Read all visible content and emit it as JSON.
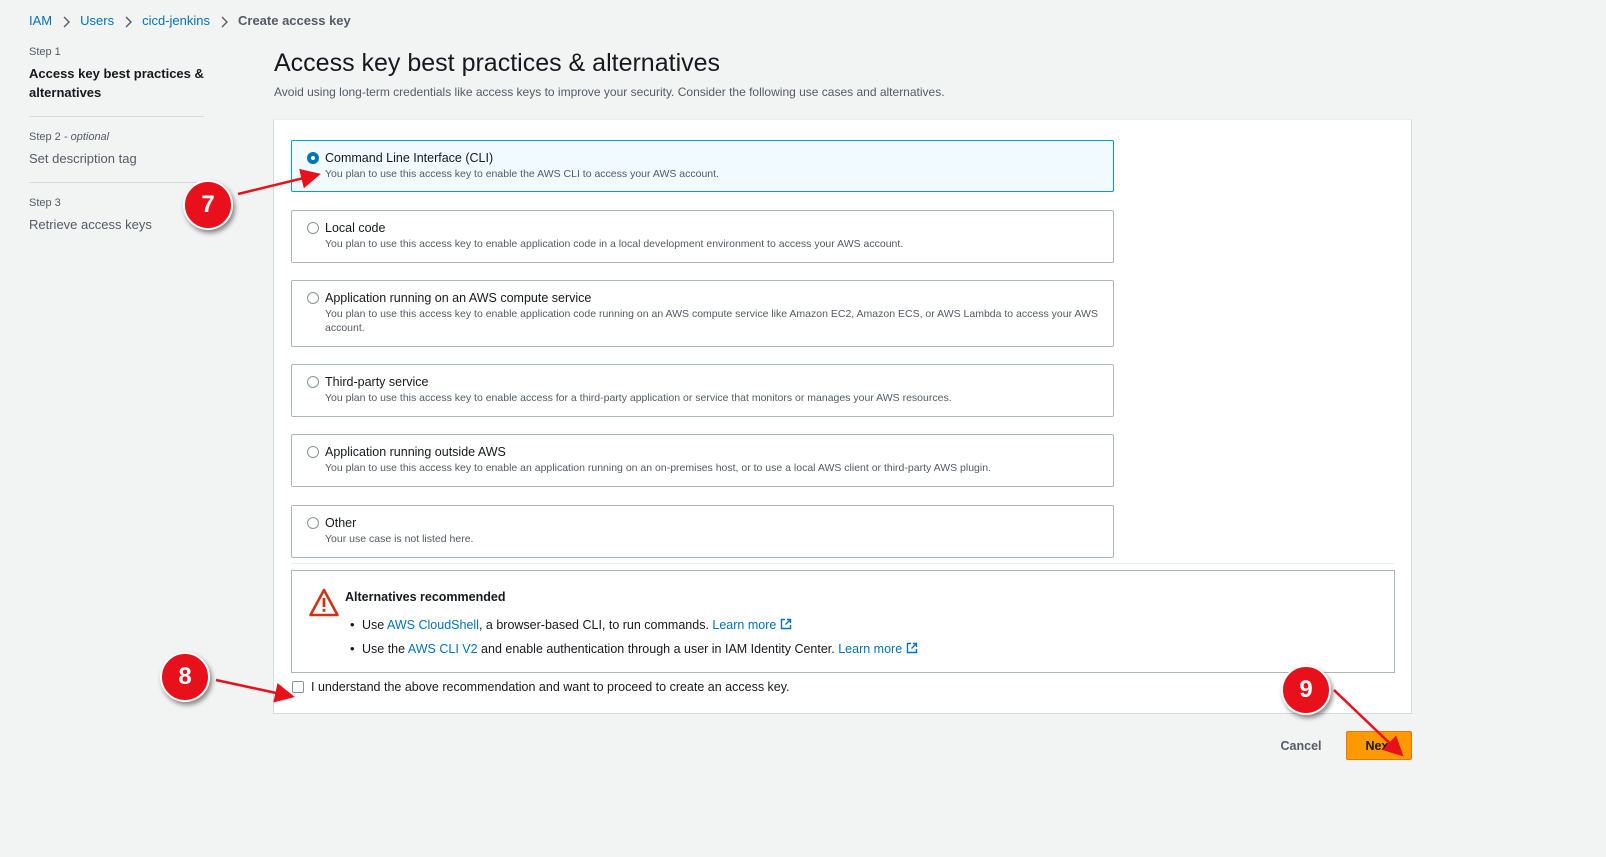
{
  "breadcrumb": {
    "items": [
      "IAM",
      "Users",
      "cicd-jenkins"
    ],
    "current": "Create access key"
  },
  "steps": [
    {
      "num": "Step 1",
      "optional": "",
      "title": "Access key best practices & alternatives"
    },
    {
      "num": "Step 2",
      "optional": " - optional",
      "title": "Set description tag"
    },
    {
      "num": "Step 3",
      "optional": "",
      "title": "Retrieve access keys"
    }
  ],
  "header": {
    "title": "Access key best practices & alternatives",
    "description": "Avoid using long-term credentials like access keys to improve your security. Consider the following use cases and alternatives."
  },
  "options": [
    {
      "title": "Command Line Interface (CLI)",
      "desc": "You plan to use this access key to enable the AWS CLI to access your AWS account.",
      "selected": true
    },
    {
      "title": "Local code",
      "desc": "You plan to use this access key to enable application code in a local development environment to access your AWS account.",
      "selected": false
    },
    {
      "title": "Application running on an AWS compute service",
      "desc": "You plan to use this access key to enable application code running on an AWS compute service like Amazon EC2, Amazon ECS, or AWS Lambda to access your AWS account.",
      "selected": false
    },
    {
      "title": "Third-party service",
      "desc": "You plan to use this access key to enable access for a third-party application or service that monitors or manages your AWS resources.",
      "selected": false
    },
    {
      "title": "Application running outside AWS",
      "desc": "You plan to use this access key to enable an application running on an on-premises host, or to use a local AWS client or third-party AWS plugin.",
      "selected": false
    },
    {
      "title": "Other",
      "desc": "Your use case is not listed here.",
      "selected": false
    }
  ],
  "alert": {
    "title": "Alternatives recommended",
    "item1": {
      "prefix": "Use ",
      "link": "AWS CloudShell",
      "suffix": ", a browser-based CLI, to run commands. ",
      "learn": "Learn more"
    },
    "item2": {
      "prefix": "Use the ",
      "link": "AWS CLI V2",
      "suffix": " and enable authentication through a user in IAM Identity Center. ",
      "learn": "Learn more"
    }
  },
  "acknowledge": {
    "label": "I understand the above recommendation and want to proceed to create an access key.",
    "checked": false
  },
  "footer": {
    "cancel": "Cancel",
    "next": "Next"
  },
  "markers": [
    "7",
    "8",
    "9"
  ],
  "colors": {
    "link": "#0073bb",
    "primary_button": "#ff9900",
    "marker": "#e8111b",
    "selected_border": "#00a1c9"
  }
}
